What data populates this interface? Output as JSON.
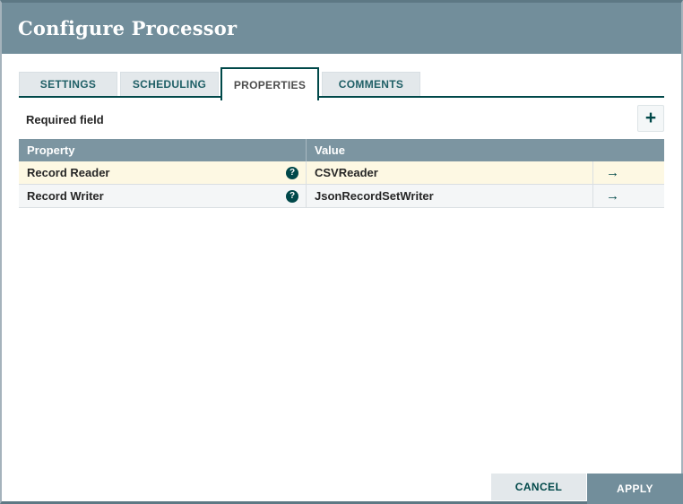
{
  "dialog": {
    "title": "Configure Processor"
  },
  "tabs": [
    {
      "label": "SETTINGS",
      "active": false
    },
    {
      "label": "SCHEDULING",
      "active": false
    },
    {
      "label": "PROPERTIES",
      "active": true
    },
    {
      "label": "COMMENTS",
      "active": false
    }
  ],
  "properties_panel": {
    "required_label": "Required field"
  },
  "icons": {
    "plus": "+",
    "help": "?",
    "goto": "→"
  },
  "table": {
    "columns": [
      "Property",
      "Value"
    ],
    "rows": [
      {
        "property": "Record Reader",
        "value": "CSVReader",
        "required": true,
        "selected": true
      },
      {
        "property": "Record Writer",
        "value": "JsonRecordSetWriter",
        "required": true,
        "selected": false
      }
    ]
  },
  "footer": {
    "cancel_label": "CANCEL",
    "apply_label": "APPLY"
  },
  "colors": {
    "header_bg": "#728e9b",
    "accent_teal": "#004849",
    "tab_inactive_bg": "#e3e8eb",
    "table_header_bg": "#7c95a1",
    "selected_row_bg": "#fdf8e3",
    "alt_row_bg": "#f4f6f7",
    "cancel_button_bg": "#e3e8eb",
    "apply_button_bg": "#728e9b"
  }
}
